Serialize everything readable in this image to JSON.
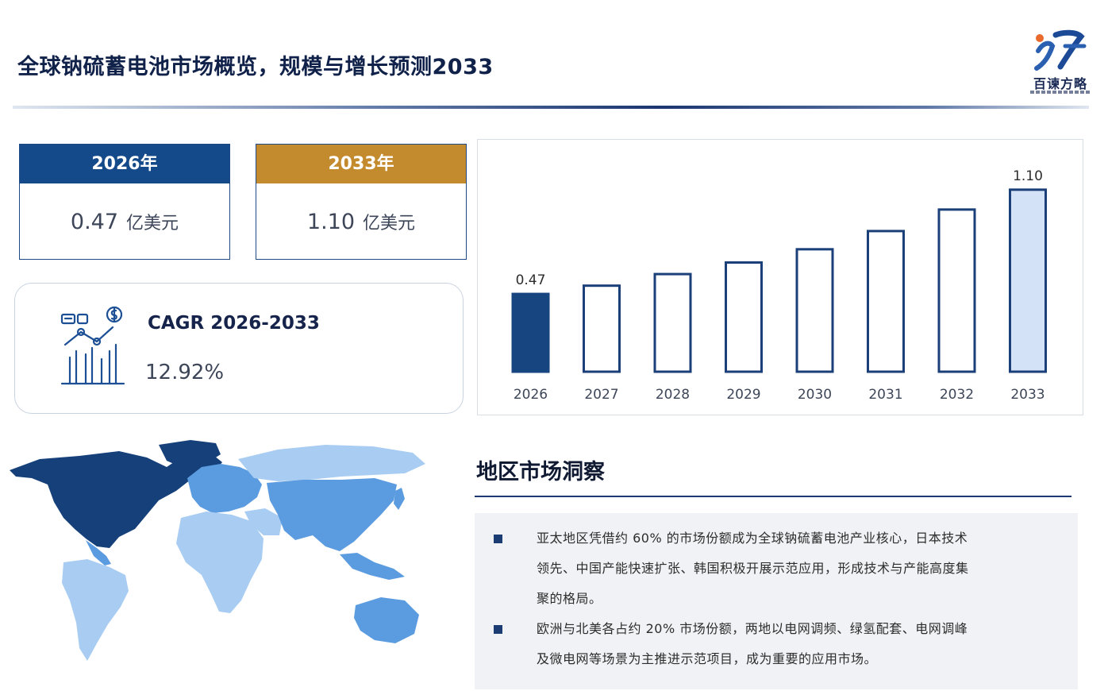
{
  "header": {
    "title": "全球钠硫蓄电池市场概览，规模与增长预测2033",
    "logo_text": "百谏方略",
    "logo_mark": "洞"
  },
  "stats": [
    {
      "year_label": "2026年",
      "value": "0.47",
      "unit": "亿美元",
      "header_color": "#154a8a"
    },
    {
      "year_label": "2033年",
      "value": "1.10",
      "unit": "亿美元",
      "header_color": "#c48b2e"
    }
  ],
  "cagr": {
    "label": "CAGR 2026-2033",
    "value": "12.92%",
    "icon": "growth-chart-icon"
  },
  "colors": {
    "dark_bar": "#17457f",
    "outline": "#1b3f78",
    "light_bar": "#d3e2f6",
    "map_dark": "#16407a",
    "map_mid": "#5b9be0",
    "map_light": "#a9cdf2"
  },
  "chart_data": {
    "type": "bar",
    "categories": [
      "2026",
      "2027",
      "2028",
      "2029",
      "2030",
      "2031",
      "2032",
      "2033"
    ],
    "values": [
      0.47,
      0.52,
      0.59,
      0.66,
      0.74,
      0.85,
      0.98,
      1.1
    ],
    "data_labels": [
      "0.47",
      "",
      "",
      "",
      "",
      "",
      "",
      "1.10"
    ],
    "title": "",
    "xlabel": "",
    "ylabel": "",
    "ylim": [
      0,
      1.2
    ],
    "grid": false
  },
  "region": {
    "title": "地区市场洞察",
    "insights": [
      {
        "lines": [
          "亚太地区凭借约 60% 的市场份额成为全球钠硫蓄电池产业核心，日本技术",
          "领先、中国产能快速扩张、韩国积极开展示范应用，形成技术与产能高度集",
          "聚的格局。"
        ]
      },
      {
        "lines": [
          "欧洲与北美各占约 20% 市场份额，两地以电网调频、绿氢配套、电网调峰",
          "及微电网等场景为主推进示范项目，成为重要的应用市场。"
        ]
      }
    ]
  }
}
